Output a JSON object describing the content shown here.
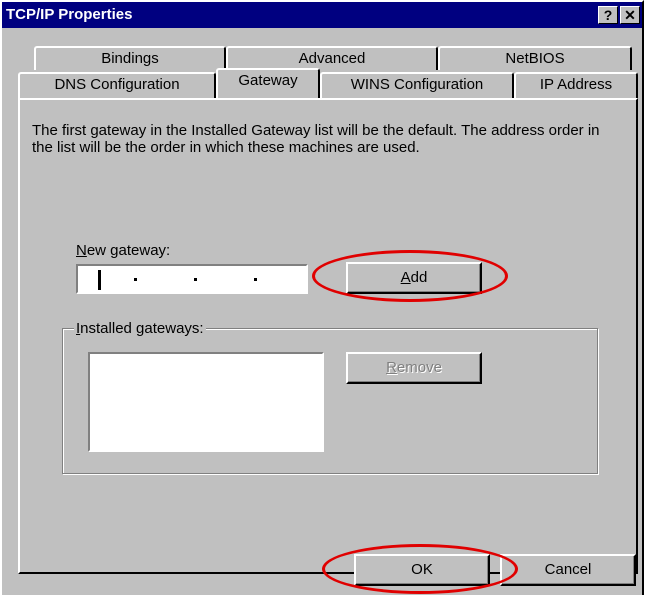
{
  "window": {
    "title": "TCP/IP Properties",
    "help_label": "?",
    "close_label": "✕"
  },
  "tabs_row1": [
    {
      "label": "Bindings"
    },
    {
      "label": "Advanced"
    },
    {
      "label": "NetBIOS"
    }
  ],
  "tabs_row2": [
    {
      "label": "DNS Configuration"
    },
    {
      "label": "Gateway",
      "active": true
    },
    {
      "label": "WINS Configuration"
    },
    {
      "label": "IP Address"
    }
  ],
  "gateway": {
    "description": "The first gateway in the Installed Gateway list will be the default. The address order in the list will be the order in which these machines are used.",
    "new_gateway_label_accel": "N",
    "new_gateway_label_rest": "ew gateway:",
    "add_accel": "A",
    "add_rest": "dd",
    "installed_label_accel": "I",
    "installed_label_rest": "nstalled gateways:",
    "remove_accel": "R",
    "remove_rest": "emove",
    "installed_items": []
  },
  "footer": {
    "ok_label": "OK",
    "cancel_label": "Cancel"
  },
  "colors": {
    "face": "#c0c0c0",
    "titlebar": "#000080",
    "annotation": "#e00000"
  }
}
